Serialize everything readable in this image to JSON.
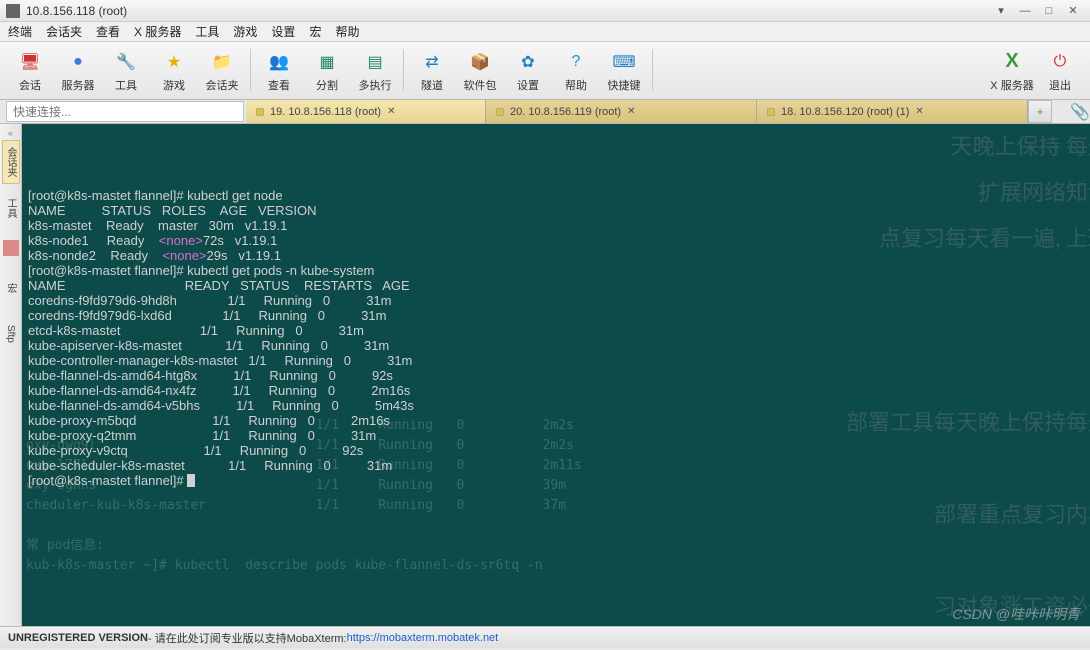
{
  "window": {
    "title": "10.8.156.118 (root)"
  },
  "menu": [
    "终端",
    "会话夹",
    "查看",
    "X 服务器",
    "工具",
    "游戏",
    "设置",
    "宏",
    "帮助"
  ],
  "toolbar": {
    "items": [
      {
        "label": "会话",
        "icon": "🖥",
        "color": "#cc3333"
      },
      {
        "label": "服务器",
        "icon": "●",
        "color": "#3a7ad8"
      },
      {
        "label": "工具",
        "icon": "🔧",
        "color": "#a07000"
      },
      {
        "label": "游戏",
        "icon": "★",
        "color": "#e6b000"
      },
      {
        "label": "会话夹",
        "icon": "📁",
        "color": "#d88000"
      },
      {
        "label": "查看",
        "icon": "👥",
        "color": "#1a865a"
      },
      {
        "label": "分割",
        "icon": "▦",
        "color": "#1a865a"
      },
      {
        "label": "多执行",
        "icon": "▤",
        "color": "#1a865a"
      },
      {
        "label": "隧道",
        "icon": "⇄",
        "color": "#2080c0"
      },
      {
        "label": "软件包",
        "icon": "📦",
        "color": "#c06000"
      },
      {
        "label": "设置",
        "icon": "✿",
        "color": "#2080c0"
      },
      {
        "label": "帮助",
        "icon": "?",
        "color": "#2090d0"
      },
      {
        "label": "快捷键",
        "icon": "⌨",
        "color": "#2080c0"
      }
    ],
    "right": [
      {
        "name": "xserver",
        "label": "X 服务器"
      },
      {
        "name": "exit",
        "label": "退出"
      }
    ]
  },
  "quick": {
    "placeholder": "快速连接..."
  },
  "tabs": [
    {
      "label": "19. 10.8.156.118 (root)",
      "active": true
    },
    {
      "label": "20. 10.8.156.119 (root)",
      "active": false
    },
    {
      "label": "18. 10.8.156.120 (root) (1)",
      "active": false
    }
  ],
  "sidebar": [
    "会话夹",
    "工具",
    "宏",
    "Sftp"
  ],
  "terminal": {
    "prompt1": "[root@k8s-mastet flannel]# ",
    "cmd1": "kubectl get node",
    "nodes_header": "NAME          STATUS   ROLES    AGE   VERSION",
    "nodes": [
      {
        "name": "k8s-mastet",
        "status": "Ready",
        "roles": "master",
        "age": "30m",
        "ver": "v1.19.1"
      },
      {
        "name": "k8s-node1 ",
        "status": "Ready",
        "roles": "<none>",
        "age": "72s",
        "ver": "v1.19.1"
      },
      {
        "name": "k8s-nonde2",
        "status": "Ready",
        "roles": "<none>",
        "age": "29s",
        "ver": "v1.19.1"
      }
    ],
    "prompt2": "[root@k8s-mastet flannel]# ",
    "cmd2": "kubectl get pods -n kube-system",
    "pods_header": "NAME                                 READY   STATUS    RESTARTS   AGE",
    "pods": [
      {
        "name": "coredns-f9fd979d6-9hd8h             ",
        "ready": "1/1",
        "status": "Running",
        "restarts": "0",
        "age": "31m"
      },
      {
        "name": "coredns-f9fd979d6-lxd6d             ",
        "ready": "1/1",
        "status": "Running",
        "restarts": "0",
        "age": "31m"
      },
      {
        "name": "etcd-k8s-mastet                     ",
        "ready": "1/1",
        "status": "Running",
        "restarts": "0",
        "age": "31m"
      },
      {
        "name": "kube-apiserver-k8s-mastet           ",
        "ready": "1/1",
        "status": "Running",
        "restarts": "0",
        "age": "31m"
      },
      {
        "name": "kube-controller-manager-k8s-mastet  ",
        "ready": "1/1",
        "status": "Running",
        "restarts": "0",
        "age": "31m"
      },
      {
        "name": "kube-flannel-ds-amd64-htg8x         ",
        "ready": "1/1",
        "status": "Running",
        "restarts": "0",
        "age": "92s"
      },
      {
        "name": "kube-flannel-ds-amd64-nx4fz         ",
        "ready": "1/1",
        "status": "Running",
        "restarts": "0",
        "age": "2m16s"
      },
      {
        "name": "kube-flannel-ds-amd64-v5bhs         ",
        "ready": "1/1",
        "status": "Running",
        "restarts": "0",
        "age": "5m43s"
      },
      {
        "name": "kube-proxy-m5bqd                    ",
        "ready": "1/1",
        "status": "Running",
        "restarts": "0",
        "age": "2m16s"
      },
      {
        "name": "kube-proxy-q2tmm                    ",
        "ready": "1/1",
        "status": "Running",
        "restarts": "0",
        "age": "31m"
      },
      {
        "name": "kube-proxy-v9ctq                    ",
        "ready": "1/1",
        "status": "Running",
        "restarts": "0",
        "age": "92s"
      },
      {
        "name": "kube-scheduler-k8s-mastet           ",
        "ready": "1/1",
        "status": "Running",
        "restarts": "0",
        "age": "31m"
      }
    ],
    "prompt3": "[root@k8s-mastet flannel]# "
  },
  "status": {
    "unreg": "UNREGISTERED VERSION",
    "text": " - 请在此处订阅专业版以支持MobaXterm: ",
    "link": "https://mobaxterm.mobatek.net"
  },
  "watermark": "CSDN @哇咔咔明青",
  "bg_lines": [
    "天晚上保持 每天",
    "扩展网络知识",
    "点复习每天看一遍, 上班",
    "",
    "",
    "",
    "部署工具每天晚上保持每天",
    "",
    "部署重点复习内容",
    "",
    "习对象涨工资必备"
  ]
}
